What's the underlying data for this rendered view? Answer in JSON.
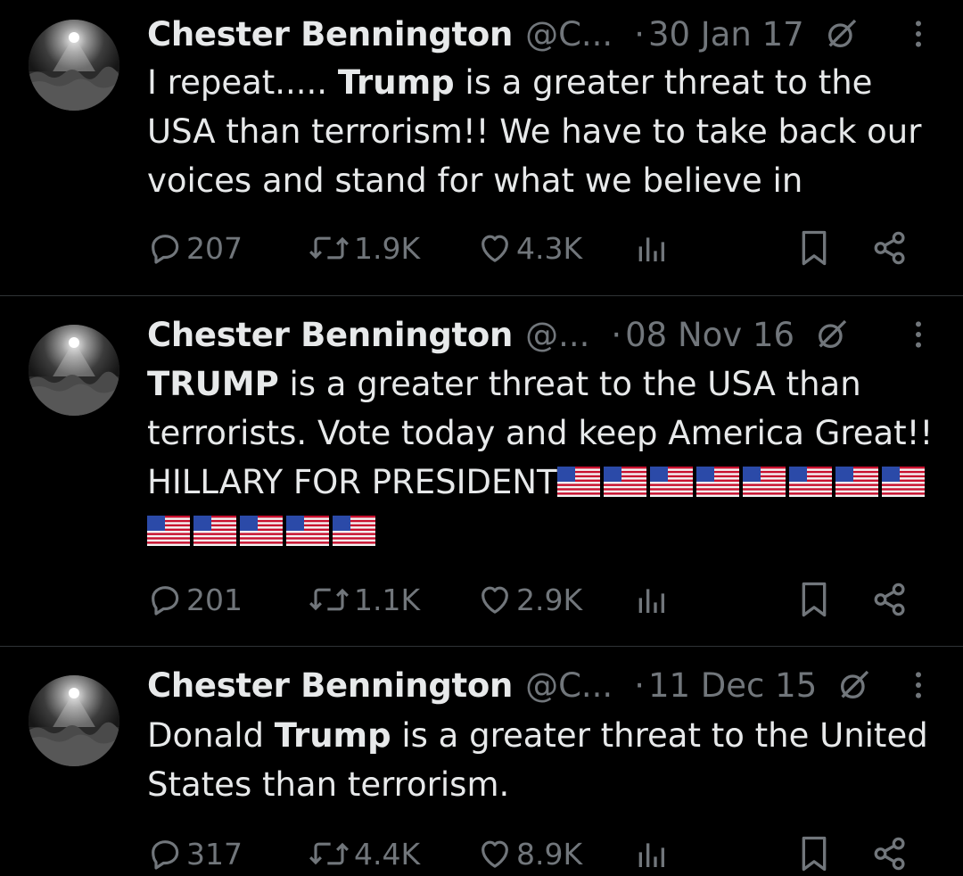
{
  "colors": {
    "background": "#000000",
    "text": "#e7e9ea",
    "secondary": "#71767b",
    "divider": "#2f3336"
  },
  "tweets": [
    {
      "name": "Chester Bennington",
      "handle": "@C...",
      "separator": "·",
      "date": "30 Jan 17",
      "text_parts": [
        "I repeat..... ",
        "Trump",
        " is a greater threat to the USA than terrorism!! We have to take back our voices and stand for what we believe in"
      ],
      "replies": "207",
      "retweets": "1.9K",
      "likes": "4.3K",
      "icons": [
        "reply-icon",
        "retweet-icon",
        "like-icon",
        "views-icon",
        "bookmark-icon",
        "share-icon"
      ]
    },
    {
      "name": "Chester Bennington",
      "handle": "@...",
      "separator": "·",
      "date": "08 Nov 16",
      "text_parts": [
        "TRUMP",
        " is a greater threat to the USA than terrorists. Vote today and keep America Great!! HILLARY FOR PRESIDENT"
      ],
      "flags": 13,
      "replies": "201",
      "retweets": "1.1K",
      "likes": "2.9K",
      "icons": [
        "reply-icon",
        "retweet-icon",
        "like-icon",
        "views-icon",
        "bookmark-icon",
        "share-icon"
      ]
    },
    {
      "name": "Chester Bennington",
      "handle": "@C...",
      "separator": "·",
      "date": "11 Dec 15",
      "text_parts": [
        "Donald ",
        "Trump",
        " is a greater threat to the United States than terrorism."
      ],
      "replies": "317",
      "retweets": "4.4K",
      "likes": "8.9K",
      "icons": [
        "reply-icon",
        "retweet-icon",
        "like-icon",
        "views-icon",
        "bookmark-icon",
        "share-icon"
      ]
    }
  ]
}
